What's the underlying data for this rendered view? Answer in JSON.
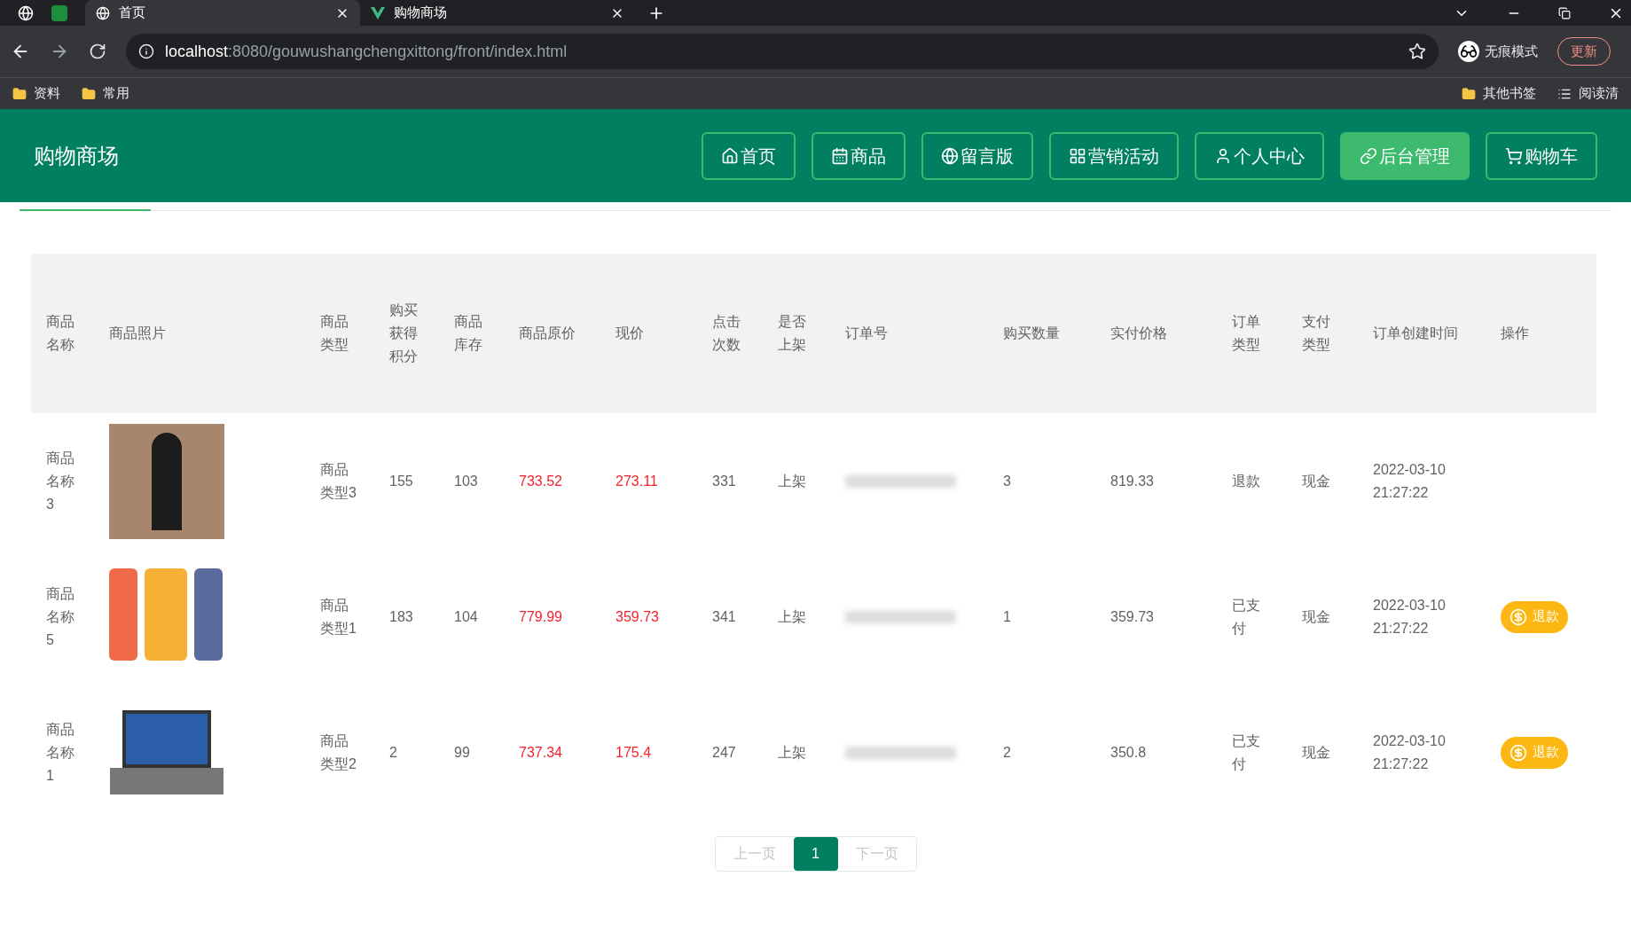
{
  "browser": {
    "tabs": [
      {
        "title": "首页",
        "selected": true
      },
      {
        "title": "购物商场",
        "selected": false
      }
    ],
    "url_host": "localhost",
    "url_rest": ":8080/gouwushangchengxittong/front/index.html",
    "incognito_label": "无痕模式",
    "update_label": "更新",
    "bookmarks_left": [
      "资料",
      "常用"
    ],
    "bookmarks_right": [
      "其他书签",
      "阅读清"
    ]
  },
  "header": {
    "title": "购物商场",
    "nav": [
      {
        "label": "首页",
        "selected": false
      },
      {
        "label": "商品",
        "selected": false
      },
      {
        "label": "留言版",
        "selected": false
      },
      {
        "label": "营销活动",
        "selected": false
      },
      {
        "label": "个人中心",
        "selected": false
      },
      {
        "label": "后台管理",
        "selected": true
      },
      {
        "label": "购物车",
        "selected": false
      }
    ]
  },
  "table": {
    "columns": [
      "商品名称",
      "商品照片",
      "商品类型",
      "购买获得积分",
      "商品库存",
      "商品原价",
      "现价",
      "点击次数",
      "是否上架",
      "订单号",
      "购买数量",
      "实付价格",
      "订单类型",
      "支付类型",
      "订单创建时间",
      "操作"
    ],
    "rows": [
      {
        "name": "商品名称3",
        "kind": "suit",
        "type": "商品类型3",
        "points": "155",
        "stock": "103",
        "original_price": "733.52",
        "price": "273.11",
        "clicks": "331",
        "on_shelf": "上架",
        "quantity": "3",
        "paid": "819.33",
        "order_type": "退款",
        "pay_type": "现金",
        "created": "2022-03-10 21:27:22"
      },
      {
        "name": "商品名称5",
        "kind": "phones",
        "type": "商品类型1",
        "points": "183",
        "stock": "104",
        "original_price": "779.99",
        "price": "359.73",
        "clicks": "341",
        "on_shelf": "上架",
        "quantity": "1",
        "paid": "359.73",
        "order_type": "已支付",
        "pay_type": "现金",
        "created": "2022-03-10 21:27:22",
        "action": "退款"
      },
      {
        "name": "商品名称1",
        "kind": "laptop",
        "type": "商品类型2",
        "points": "2",
        "stock": "99",
        "original_price": "737.34",
        "price": "175.4",
        "clicks": "247",
        "on_shelf": "上架",
        "quantity": "2",
        "paid": "350.8",
        "order_type": "已支付",
        "pay_type": "现金",
        "created": "2022-03-10 21:27:22",
        "action": "退款"
      }
    ]
  },
  "pagination": {
    "prev": "上一页",
    "pages": [
      {
        "label": "1",
        "selected": true
      }
    ],
    "next": "下一页"
  }
}
